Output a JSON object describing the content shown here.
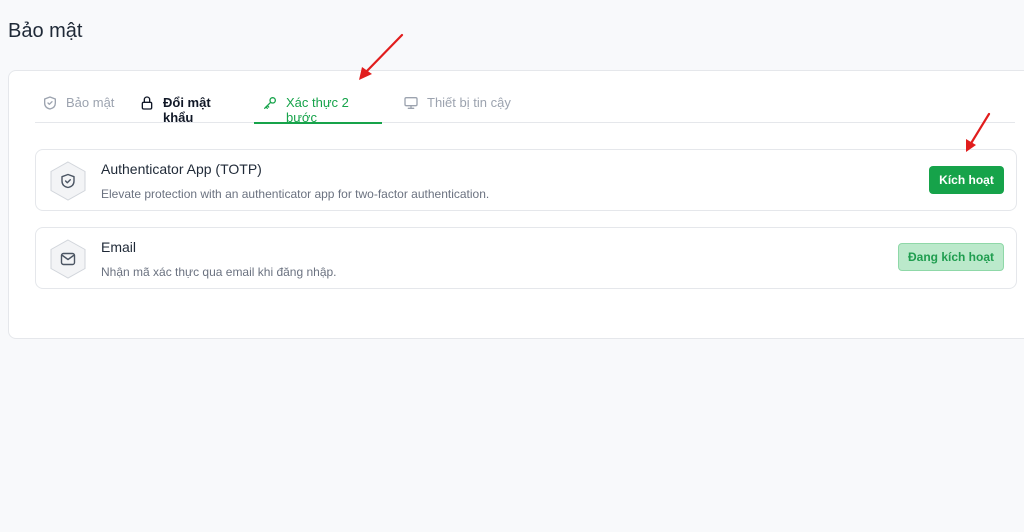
{
  "page": {
    "title": "Bảo mật"
  },
  "tabs": [
    {
      "label": "Bảo mật",
      "icon": "shield-check-icon"
    },
    {
      "label": "Đổi mật khẩu",
      "icon": "lock-icon"
    },
    {
      "label": "Xác thực 2 bước",
      "icon": "key-icon",
      "active": true
    },
    {
      "label": "Thiết bị tin cậy",
      "icon": "monitor-icon"
    }
  ],
  "methods": [
    {
      "title": "Authenticator App (TOTP)",
      "description": "Elevate protection with an authenticator app for two-factor authentication.",
      "icon": "shield-check-icon",
      "button_label": "Kích hoạt"
    },
    {
      "title": "Email",
      "description": "Nhận mã xác thực qua email khi đăng nhập.",
      "icon": "mail-icon",
      "status_label": "Đang kích hoạt"
    }
  ],
  "colors": {
    "accent": "#16a34a",
    "annotation_arrow": "#e11d1d"
  }
}
